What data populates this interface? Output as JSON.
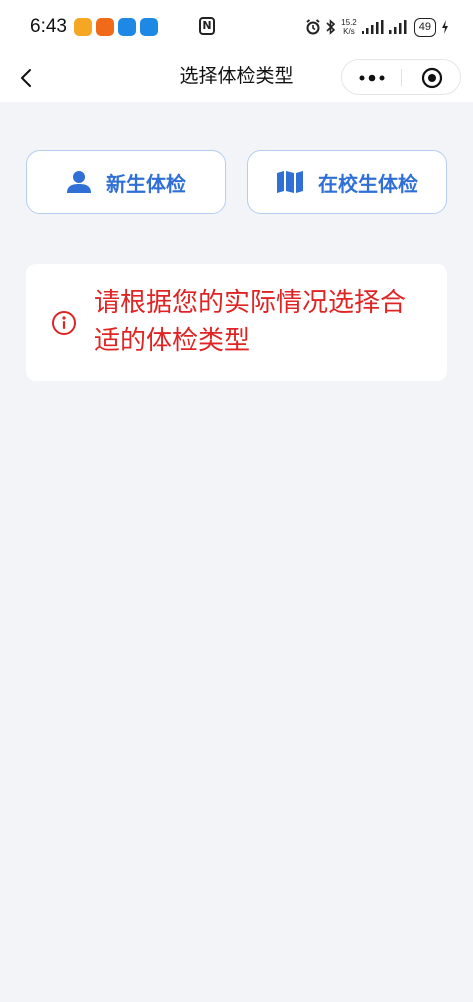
{
  "status_bar": {
    "time": "6:43",
    "nfc": "N",
    "network_speed_value": "15.2",
    "network_speed_unit": "K/s",
    "battery": "49"
  },
  "nav": {
    "title": "选择体检类型"
  },
  "buttons": {
    "new_student": "新生体检",
    "in_school": "在校生体检"
  },
  "notice": {
    "text": "请根据您的实际情况选择合适的体检类型"
  },
  "colors": {
    "accent": "#2f6fd6",
    "notice_red": "#e02424",
    "background": "#f3f4f8"
  },
  "icons": {
    "new_student": "user-icon",
    "in_school": "map-icon",
    "notice": "info-icon"
  }
}
